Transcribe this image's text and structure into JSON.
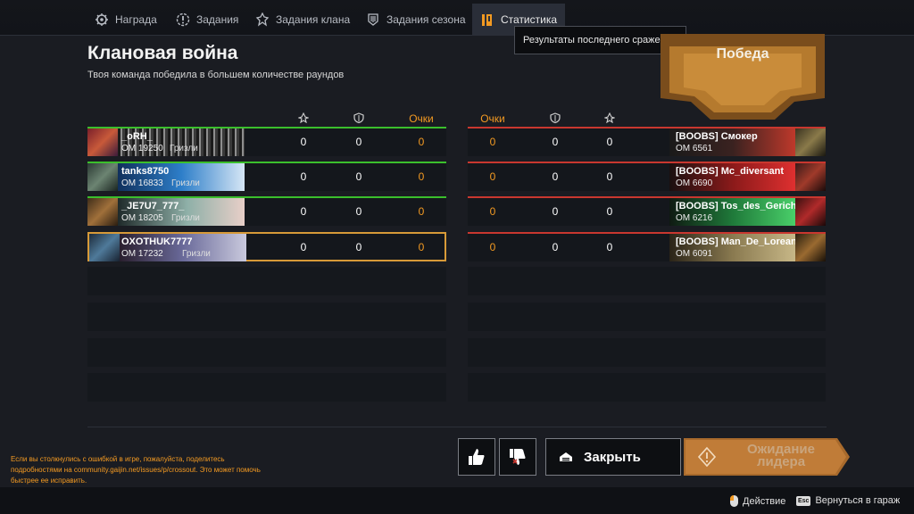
{
  "tabs": [
    {
      "label": "Награда",
      "icon": "gear-icon"
    },
    {
      "label": "Задания",
      "icon": "exclamation-gear-icon"
    },
    {
      "label": "Задания клана",
      "icon": "flame-icon"
    },
    {
      "label": "Задания сезона",
      "icon": "bars-badge-icon"
    },
    {
      "label": "Статистика",
      "icon": "book-icon",
      "active": true
    }
  ],
  "tooltip": "Результаты последнего сражения.",
  "header": {
    "title": "Клановая война",
    "subtitle": "Твоя команда победила в большем количестве раундов",
    "result": "Победа"
  },
  "columns": {
    "kills_icon": "skull-cross-icon",
    "assists_icon": "shield-icon",
    "points": "Очки"
  },
  "team_left": [
    {
      "name": "_oRH_",
      "rating": "ОМ 19250",
      "rank": "Гризли",
      "kills": "0",
      "assists": "0",
      "points": "0"
    },
    {
      "name": "tanks8750",
      "rating": "ОМ 16833",
      "rank": "Гризли",
      "kills": "0",
      "assists": "0",
      "points": "0"
    },
    {
      "name": "_JE7U7_777_",
      "rating": "ОМ 18205",
      "rank": "Гризли",
      "kills": "0",
      "assists": "0",
      "points": "0"
    },
    {
      "name": "OXOTHUK7777",
      "rating": "ОМ 17232",
      "rank": "Гризли",
      "kills": "0",
      "assists": "0",
      "points": "0"
    }
  ],
  "team_right": [
    {
      "name": "[BOOBS] Смокер",
      "rating": "ОМ 6561",
      "points": "0",
      "assists": "0",
      "kills": "0"
    },
    {
      "name": "[BOOBS] Mc_diversant",
      "rating": "ОМ 6690",
      "points": "0",
      "assists": "0",
      "kills": "0"
    },
    {
      "name": "[BOOBS] Tos_des_Gericht",
      "rating": "ОМ 6216",
      "points": "0",
      "assists": "0",
      "kills": "0"
    },
    {
      "name": "[BOOBS] Man_De_Lorean",
      "rating": "ОМ 6091",
      "points": "0",
      "assists": "0",
      "kills": "0"
    }
  ],
  "error_note": "Если вы столкнулись с ошибкой в игре, пожалуйста, поделитесь подробностями на community.gaijin.net/issues/p/crossout. Это может помочь быстрее ее исправить.",
  "buttons": {
    "like_icon": "thumbs-up-icon",
    "dislike_icon": "thumbs-down-icon",
    "close": "Закрыть",
    "wait": "Ожидание лидера"
  },
  "footer": {
    "action": "Действие",
    "action_icon": "mouse-icon",
    "garage": "Вернуться в гараж",
    "garage_key": "Esc"
  },
  "colors": {
    "accent": "#f39a22",
    "win": "#3bbf2c",
    "lose": "#c9372f",
    "self": "#d79a38"
  }
}
